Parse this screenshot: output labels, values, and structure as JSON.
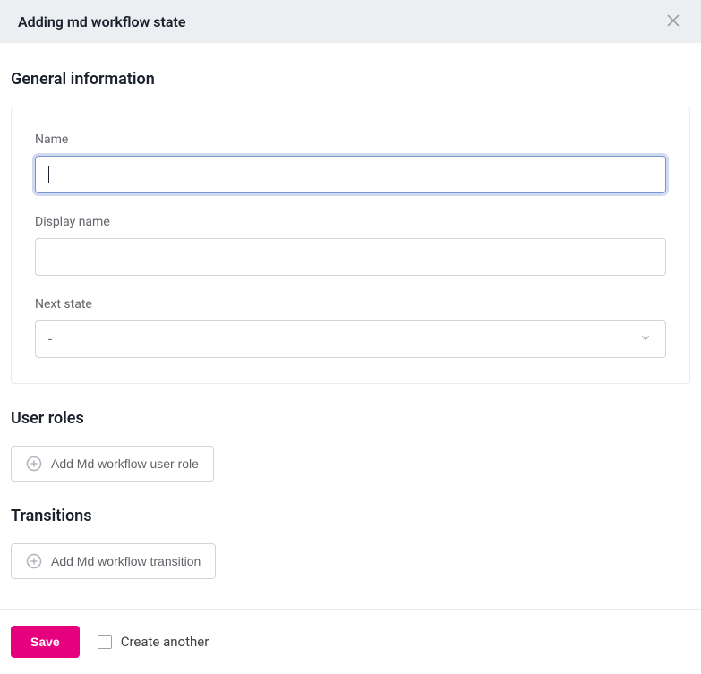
{
  "header": {
    "title": "Adding md workflow state"
  },
  "sections": {
    "general": {
      "title": "General information",
      "fields": {
        "name": {
          "label": "Name",
          "value": ""
        },
        "displayName": {
          "label": "Display name",
          "value": ""
        },
        "nextState": {
          "label": "Next state",
          "selected": "-"
        }
      }
    },
    "userRoles": {
      "title": "User roles",
      "addButtonLabel": "Add Md workflow user role"
    },
    "transitions": {
      "title": "Transitions",
      "addButtonLabel": "Add Md workflow transition"
    }
  },
  "footer": {
    "saveLabel": "Save",
    "createAnotherLabel": "Create another",
    "createAnotherChecked": false
  },
  "colors": {
    "accent": "#e6007e",
    "focusRing": "#7b96d6",
    "headerBg": "#eceff1"
  }
}
